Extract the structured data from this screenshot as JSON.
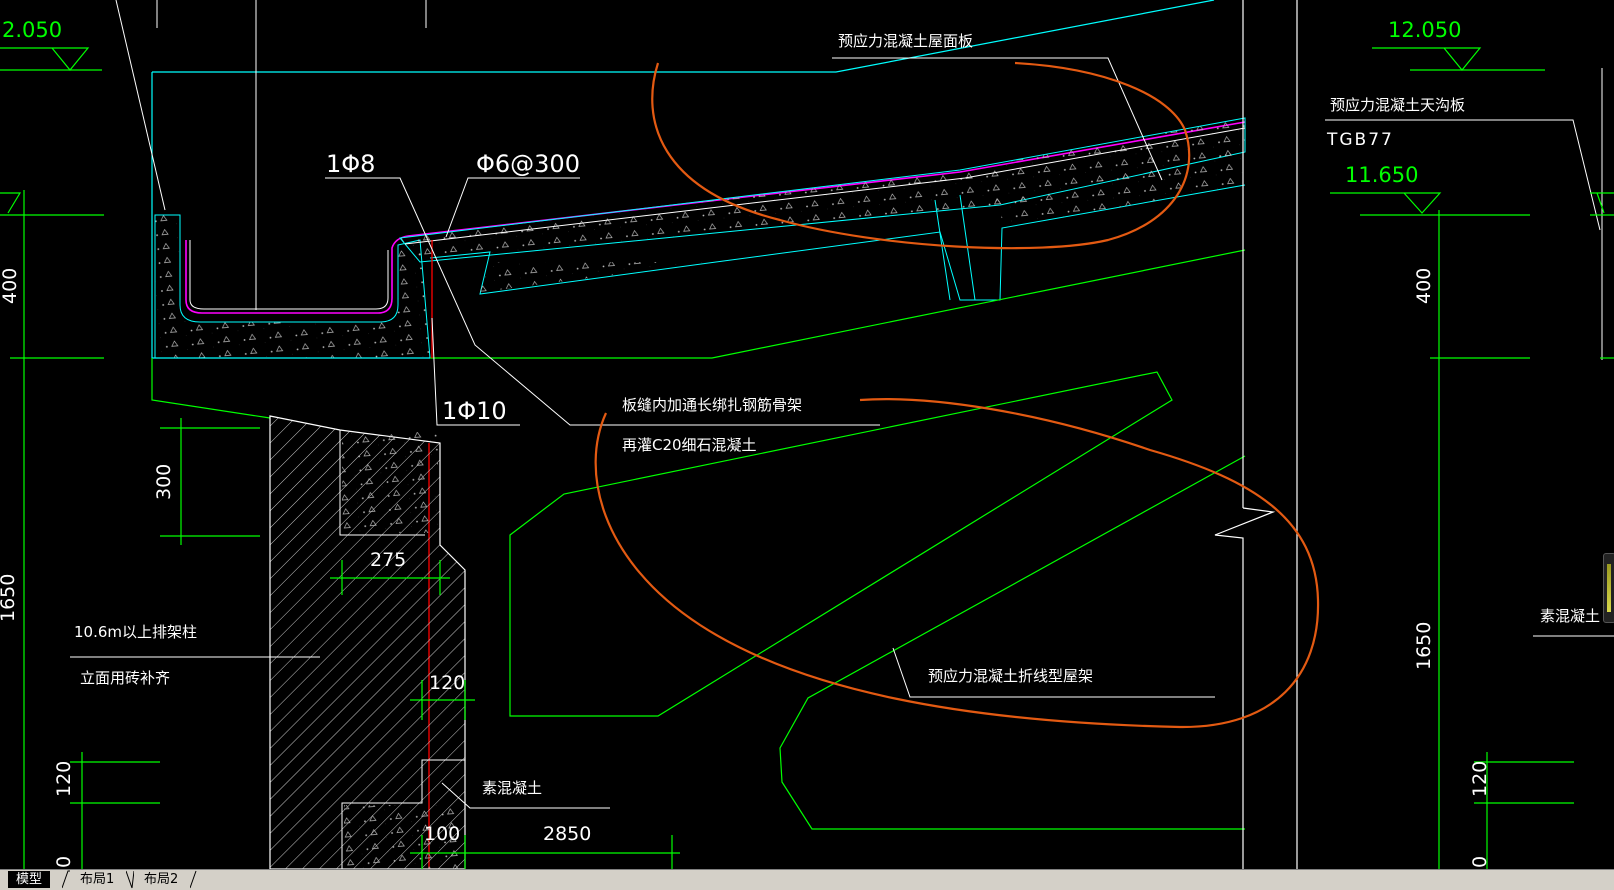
{
  "colors": {
    "background": "#000000",
    "cyan": "#00ffff",
    "green": "#00ff00",
    "white": "#ffffff",
    "red": "#ff0000",
    "magenta": "#ff00ff",
    "orange_markup": "#e35a12"
  },
  "drawing": {
    "elevations": {
      "left_top": "2.050",
      "right_top": "12.050",
      "right_second": "11.650"
    },
    "rebar": {
      "top_bar": "1Φ8",
      "stirrup": "Φ6@300",
      "bottom_bar": "1Φ10"
    },
    "notes": {
      "roof_panel": "预应力混凝土屋面板",
      "gutter_panel": "预应力混凝土天沟板",
      "gutter_code": "TGB77",
      "joint_line1": "板缝内加通长绑扎钢筋骨架",
      "joint_line2": "再灌C20细石混凝土",
      "column_line1": "10.6m以上排架柱",
      "column_line2": "立面用砖补齐",
      "plain_concrete_left": "素混凝土",
      "plain_concrete_right": "素混凝土",
      "truss": "预应力混凝土折线型屋架"
    },
    "dimensions": {
      "left_400": "400",
      "left_300": "300",
      "left_1650": "1650",
      "left_120": "120",
      "left_bottom": "0",
      "d275": "275",
      "d120": "120",
      "d100": "100",
      "d2850": "2850",
      "right_400": "400",
      "right_1650": "1650",
      "right_120": "120",
      "right_bottom": "0"
    }
  },
  "layout_tabs": {
    "model": "模型",
    "layout1": "布局1",
    "layout2": "布局2"
  }
}
